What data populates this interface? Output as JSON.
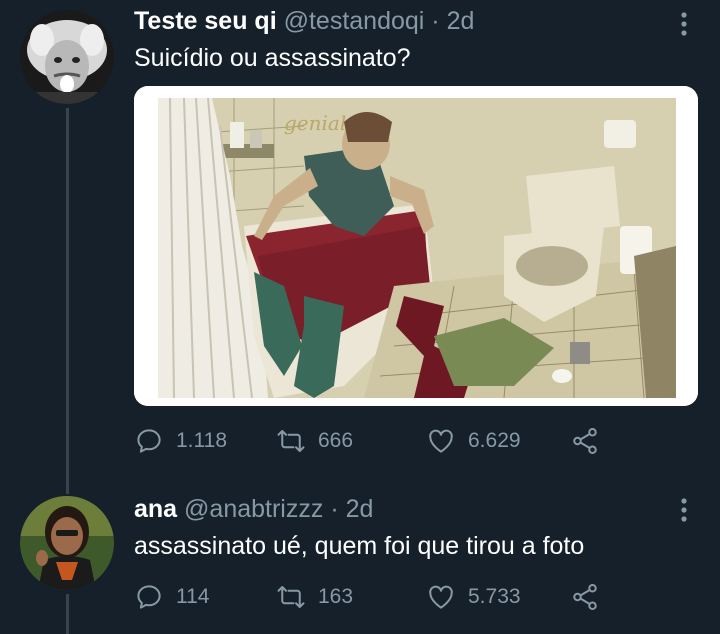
{
  "tweet": {
    "author_name": "Teste seu qi",
    "handle": "@testandoqi",
    "separator": "·",
    "time": "2d",
    "text": "Suicídio ou assassinato?",
    "media_watermark": "genial",
    "stats": {
      "replies": "1.118",
      "retweets": "666",
      "likes": "6.629"
    }
  },
  "reply": {
    "author_name": "ana",
    "handle": "@anabtrizzz",
    "separator": "·",
    "time": "2d",
    "text": "assassinato ué, quem foi que tirou a foto",
    "stats": {
      "replies": "114",
      "retweets": "163",
      "likes": "5.733"
    }
  },
  "colors": {
    "background": "#15202b",
    "secondary_text": "#8899a6",
    "thread_line": "#38444d"
  },
  "icons": [
    "more-icon",
    "reply-icon",
    "retweet-icon",
    "like-icon",
    "share-icon"
  ]
}
